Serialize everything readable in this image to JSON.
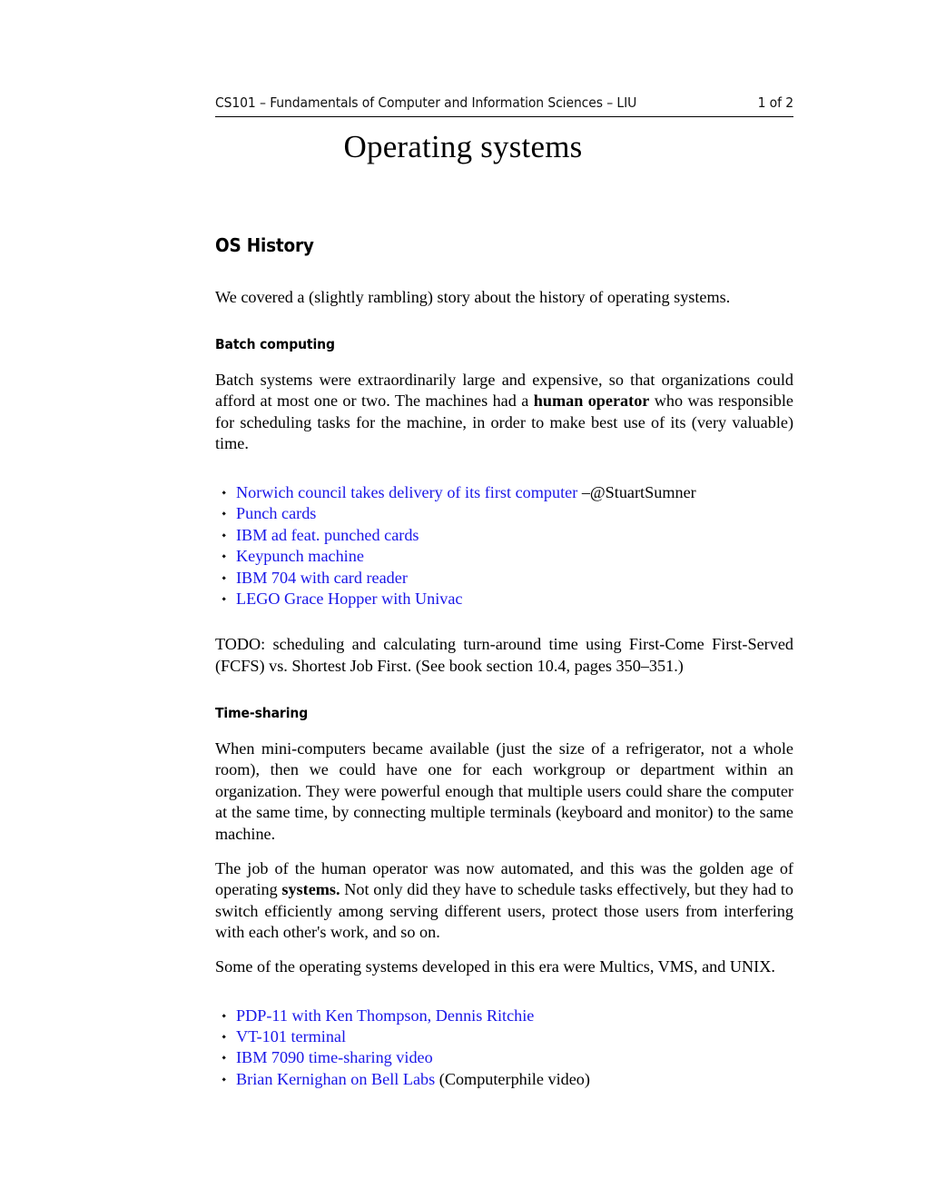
{
  "header": {
    "course": "CS101 – Fundamentals of Computer and Information Sciences – LIU",
    "page_number": "1 of 2"
  },
  "title": "Operating systems",
  "sections": {
    "os_history": {
      "heading": "OS History",
      "intro": "We covered a (slightly rambling) story about the history of operating systems.",
      "batch": {
        "heading": "Batch computing",
        "para_before_bold": "Batch systems were extraordinarily large and expensive, so that organizations could afford at most one or two. The machines had a ",
        "para_bold": "human operator",
        "para_after_bold": " who was responsible for scheduling tasks for the machine, in order to make best use of its (very valuable) time.",
        "links": [
          {
            "text": "Norwich council takes delivery of its first computer",
            "suffix": " –@StuartSumner"
          },
          {
            "text": "Punch cards",
            "suffix": ""
          },
          {
            "text": "IBM ad feat. punched cards",
            "suffix": ""
          },
          {
            "text": "Keypunch machine",
            "suffix": ""
          },
          {
            "text": "IBM 704 with card reader",
            "suffix": ""
          },
          {
            "text": "LEGO Grace Hopper with Univac",
            "suffix": ""
          }
        ],
        "todo": "TODO: scheduling and calculating turn-around time using First-Come First-Served (FCFS) vs. Shortest Job First. (See book section 10.4, pages 350–351.)"
      },
      "timesharing": {
        "heading": "Time-sharing",
        "para1": "When mini-computers became available (just the size of a refrigerator, not a whole room), then we could have one for each workgroup or department within an organization. They were powerful enough that multiple users could share the computer at the same time, by connecting multiple terminals (keyboard and monitor) to the same machine.",
        "para2_before_bold": "The job of the human operator was now automated, and this was the golden age of operating ",
        "para2_bold": "systems.",
        "para2_after_bold": " Not only did they have to schedule tasks effectively, but they had to switch efficiently among serving different users, protect those users from interfering with each other's work, and so on.",
        "para3": "Some of the operating systems developed in this era were Multics, VMS, and UNIX.",
        "links": [
          {
            "text": "PDP-11 with Ken Thompson, Dennis Ritchie",
            "suffix": ""
          },
          {
            "text": "VT-101 terminal",
            "suffix": ""
          },
          {
            "text": "IBM 7090 time-sharing video",
            "suffix": ""
          },
          {
            "text": "Brian Kernighan on Bell Labs",
            "suffix": " (Computerphile video)"
          }
        ]
      }
    }
  },
  "colors": {
    "link": "#1a17e8",
    "text": "#000000",
    "background": "#ffffff"
  }
}
